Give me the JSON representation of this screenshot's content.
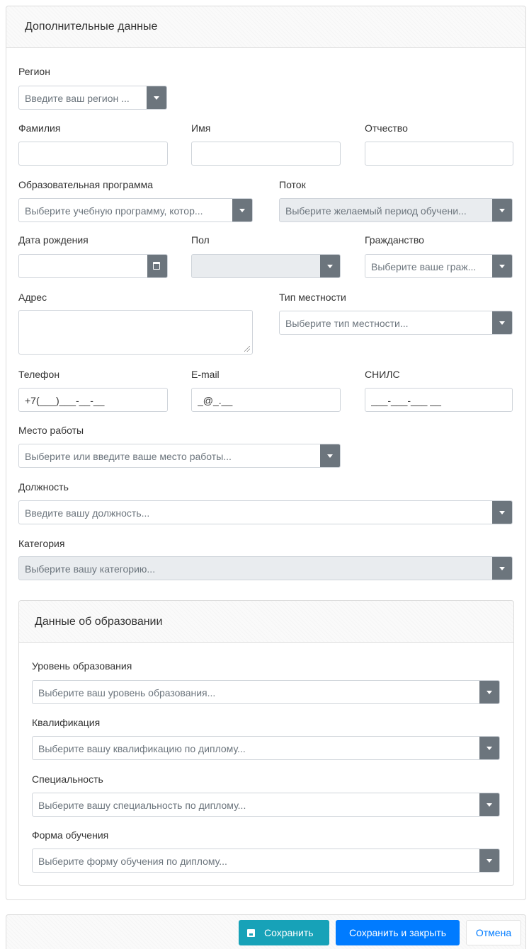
{
  "panel": {
    "title": "Дополнительные данные"
  },
  "region": {
    "label": "Регион",
    "placeholder": "Введите ваш регион ..."
  },
  "surname": {
    "label": "Фамилия",
    "value": ""
  },
  "name": {
    "label": "Имя",
    "value": ""
  },
  "patronymic": {
    "label": "Отчество",
    "value": ""
  },
  "program": {
    "label": "Образовательная программа",
    "placeholder": "Выберите учебную программу, котор..."
  },
  "stream": {
    "label": "Поток",
    "placeholder": "Выберите желаемый период обучени..."
  },
  "birthdate": {
    "label": "Дата рождения",
    "value": ""
  },
  "gender": {
    "label": "Пол",
    "value": ""
  },
  "citizenship": {
    "label": "Гражданство",
    "placeholder": "Выберите ваше граж..."
  },
  "address": {
    "label": "Адрес",
    "value": ""
  },
  "locality": {
    "label": "Тип местности",
    "placeholder": "Выберите тип местности..."
  },
  "phone": {
    "label": "Телефон",
    "value": "+7(___)___-__-__"
  },
  "email": {
    "label": "E-mail",
    "value": "_@_.__"
  },
  "snils": {
    "label": "СНИЛС",
    "value": "___-___-___ __"
  },
  "workplace": {
    "label": "Место работы",
    "placeholder": "Выберите или введите ваше место работы..."
  },
  "position": {
    "label": "Должность",
    "placeholder": "Введите вашу должность..."
  },
  "category": {
    "label": "Категория",
    "placeholder": "Выберите вашу категорию..."
  },
  "education": {
    "title": "Данные об образовании",
    "level": {
      "label": "Уровень образования",
      "placeholder": "Выберите ваш уровень образования..."
    },
    "qualification": {
      "label": "Квалификация",
      "placeholder": "Выберите вашу квалификацию по диплому..."
    },
    "specialty": {
      "label": "Специальность",
      "placeholder": "Выберите вашу специальность по диплому..."
    },
    "form": {
      "label": "Форма обучения",
      "placeholder": "Выберите форму обучения по диплому..."
    }
  },
  "footer": {
    "save_label": "Сохранить",
    "save_close_label": "Сохранить и закрыть",
    "cancel_label": "Отмена"
  },
  "colors": {
    "secondary": "#6c757d",
    "info": "#17a2b8",
    "primary": "#007bff",
    "disabled_bg": "#e9ecef"
  },
  "icons": {
    "dropdown": "caret-down-icon",
    "calendar": "calendar-icon",
    "save": "floppy-disk-icon",
    "resize": "resize-grip-icon"
  }
}
